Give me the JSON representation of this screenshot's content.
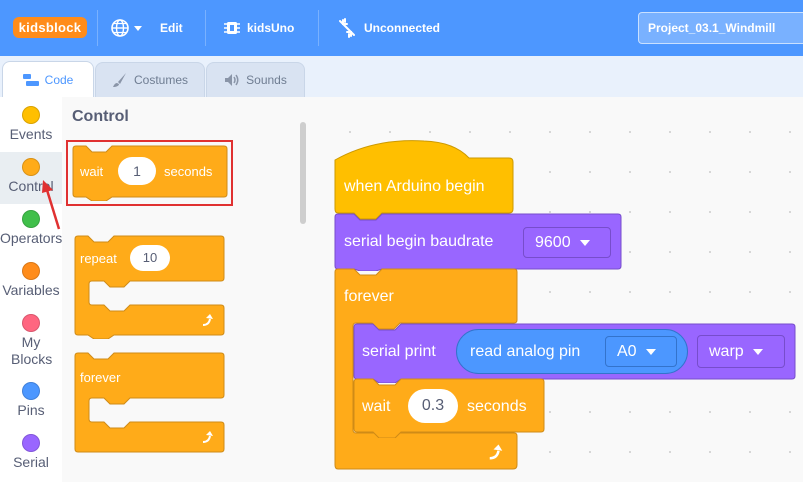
{
  "menubar": {
    "logo": "kidsblock",
    "edit_label": "Edit",
    "board_label": "kidsUno",
    "connection_label": "Unconnected",
    "project_title": "Project_03.1_Windmill"
  },
  "tabs": [
    {
      "label": "Code",
      "icon": "code-icon",
      "active": true
    },
    {
      "label": "Costumes",
      "icon": "brush-icon",
      "active": false
    },
    {
      "label": "Sounds",
      "icon": "speaker-icon",
      "active": false
    }
  ],
  "categories": [
    {
      "label": "Events",
      "color": "#ffbf00",
      "selected": false
    },
    {
      "label": "Control",
      "color": "#ffab19",
      "selected": true
    },
    {
      "label": "Operators",
      "color": "#40bf4a",
      "selected": false
    },
    {
      "label": "Variables",
      "color": "#ff8c1a",
      "selected": false
    },
    {
      "label": "My Blocks",
      "color": "#ff6680",
      "selected": false
    },
    {
      "label": "Pins",
      "color": "#4c97ff",
      "selected": false
    },
    {
      "label": "Serial",
      "color": "#9966ff",
      "selected": false
    }
  ],
  "flyout": {
    "title": "Control",
    "wait_block": {
      "prefix": "wait",
      "value": "1",
      "suffix": "seconds"
    },
    "repeat_block": {
      "label": "repeat",
      "value": "10"
    },
    "forever_block": {
      "label": "forever"
    }
  },
  "workspace": {
    "hat_label": "when Arduino begin",
    "serial_begin": {
      "label": "serial begin baudrate",
      "value": "9600"
    },
    "forever_label": "forever",
    "serial_print": {
      "label": "serial print",
      "reporter_label": "read analog pin",
      "pin": "A0",
      "mode": "warp"
    },
    "wait": {
      "prefix": "wait",
      "value": "0.3",
      "suffix": "seconds"
    }
  },
  "colors": {
    "menubar": "#4d97ff",
    "control": "#ffab19",
    "events": "#ffbf00",
    "serial": "#9966ff",
    "pins": "#4c97ff",
    "highlight": "#e03131"
  }
}
